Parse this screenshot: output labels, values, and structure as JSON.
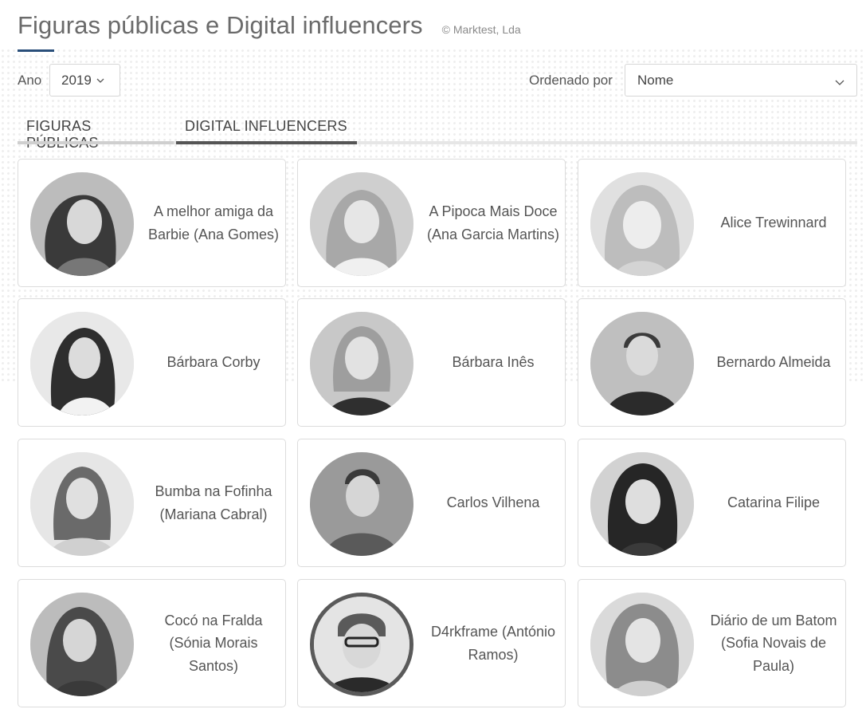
{
  "header": {
    "title": "Figuras públicas e Digital influencers",
    "copyright": "© Marktest, Lda"
  },
  "filters": {
    "year_label": "Ano",
    "year_value": "2019",
    "order_label": "Ordenado por",
    "order_value": "Nome"
  },
  "tabs": [
    {
      "label": "FIGURAS PÚBLICAS",
      "active": false
    },
    {
      "label": "DIGITAL INFLUENCERS",
      "active": true
    }
  ],
  "cards": [
    {
      "name": "A melhor amiga da Barbie (Ana Gomes)"
    },
    {
      "name": "A Pipoca Mais Doce (Ana Garcia Martins)"
    },
    {
      "name": "Alice Trewinnard"
    },
    {
      "name": "Bárbara Corby"
    },
    {
      "name": "Bárbara Inês"
    },
    {
      "name": "Bernardo Almeida"
    },
    {
      "name": "Bumba na Fofinha (Mariana Cabral)"
    },
    {
      "name": "Carlos Vilhena"
    },
    {
      "name": "Catarina Filipe"
    },
    {
      "name": "Cocó na Fralda (Sónia Morais Santos)"
    },
    {
      "name": "D4rkframe (António Ramos)"
    },
    {
      "name": "Diário de um Batom (Sofia Novais de Paula)"
    }
  ],
  "icons": {
    "dropdown": "chevron-down-icon"
  }
}
